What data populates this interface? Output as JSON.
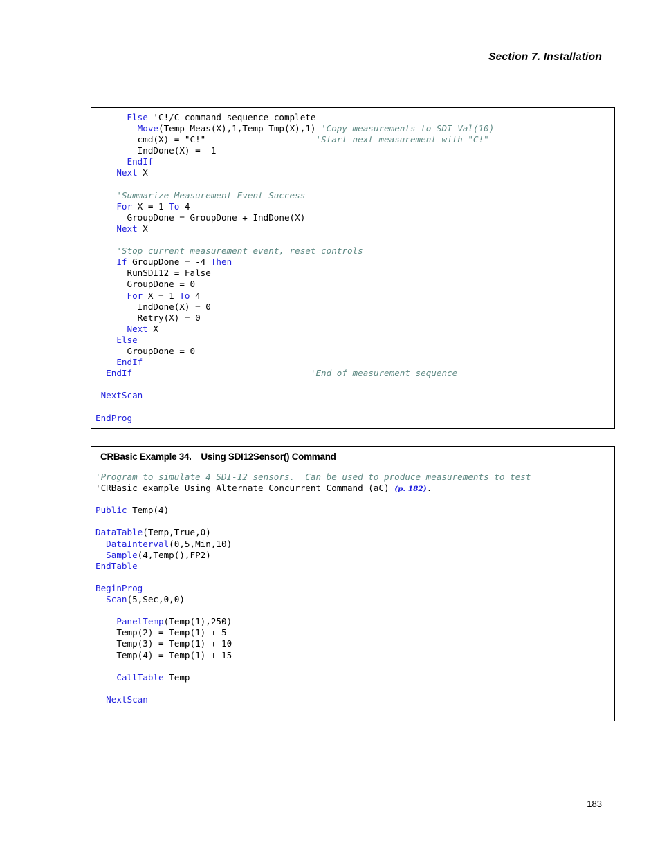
{
  "page": {
    "header_text": "Section 7.  Installation",
    "page_number": "183"
  },
  "blocks": [
    {
      "name": "crbasic-example-continued",
      "has_title": false,
      "title": "",
      "lines": [
        {
          "indent": 6,
          "segments": [
            {
              "t": "Else",
              "c": "kw"
            },
            {
              "t": " 'C!/C command sequence complete",
              "c": "plain"
            }
          ]
        },
        {
          "indent": 8,
          "segments": [
            {
              "t": "Move",
              "c": "kw"
            },
            {
              "t": "(Temp_Meas(X),1,Temp_Tmp(X),1) ",
              "c": "plain"
            },
            {
              "t": "'Copy measurements to SDI_Val(10)",
              "c": "cmt"
            }
          ]
        },
        {
          "indent": 8,
          "segments": [
            {
              "t": "cmd(X) = \"C!\"                     ",
              "c": "plain"
            },
            {
              "t": "'Start next measurement with \"C!\"",
              "c": "cmt"
            }
          ]
        },
        {
          "indent": 8,
          "segments": [
            {
              "t": "IndDone(X) = -1",
              "c": "plain"
            }
          ]
        },
        {
          "indent": 6,
          "segments": [
            {
              "t": "EndIf",
              "c": "kw"
            }
          ]
        },
        {
          "indent": 4,
          "segments": [
            {
              "t": "Next",
              "c": "kw"
            },
            {
              "t": " X",
              "c": "plain"
            }
          ]
        },
        {
          "indent": 0,
          "segments": [
            {
              "t": " ",
              "c": "plain"
            }
          ]
        },
        {
          "indent": 4,
          "segments": [
            {
              "t": "'Summarize Measurement Event Success",
              "c": "cmt"
            }
          ]
        },
        {
          "indent": 4,
          "segments": [
            {
              "t": "For",
              "c": "kw"
            },
            {
              "t": " X = 1 ",
              "c": "plain"
            },
            {
              "t": "To",
              "c": "kw"
            },
            {
              "t": " 4",
              "c": "plain"
            }
          ]
        },
        {
          "indent": 6,
          "segments": [
            {
              "t": "GroupDone = GroupDone + IndDone(X)",
              "c": "plain"
            }
          ]
        },
        {
          "indent": 4,
          "segments": [
            {
              "t": "Next",
              "c": "kw"
            },
            {
              "t": " X",
              "c": "plain"
            }
          ]
        },
        {
          "indent": 0,
          "segments": [
            {
              "t": " ",
              "c": "plain"
            }
          ]
        },
        {
          "indent": 4,
          "segments": [
            {
              "t": "'Stop current measurement event, reset controls",
              "c": "cmt"
            }
          ]
        },
        {
          "indent": 4,
          "segments": [
            {
              "t": "If",
              "c": "kw"
            },
            {
              "t": " GroupDone = -4 ",
              "c": "plain"
            },
            {
              "t": "Then",
              "c": "kw"
            }
          ]
        },
        {
          "indent": 6,
          "segments": [
            {
              "t": "RunSDI12 = False",
              "c": "plain"
            }
          ]
        },
        {
          "indent": 6,
          "segments": [
            {
              "t": "GroupDone = 0",
              "c": "plain"
            }
          ]
        },
        {
          "indent": 6,
          "segments": [
            {
              "t": "For",
              "c": "kw"
            },
            {
              "t": " X = 1 ",
              "c": "plain"
            },
            {
              "t": "To",
              "c": "kw"
            },
            {
              "t": " 4",
              "c": "plain"
            }
          ]
        },
        {
          "indent": 8,
          "segments": [
            {
              "t": "IndDone(X) = 0",
              "c": "plain"
            }
          ]
        },
        {
          "indent": 8,
          "segments": [
            {
              "t": "Retry(X) = 0",
              "c": "plain"
            }
          ]
        },
        {
          "indent": 6,
          "segments": [
            {
              "t": "Next",
              "c": "kw"
            },
            {
              "t": " X",
              "c": "plain"
            }
          ]
        },
        {
          "indent": 4,
          "segments": [
            {
              "t": "Else",
              "c": "kw"
            }
          ]
        },
        {
          "indent": 6,
          "segments": [
            {
              "t": "GroupDone = 0",
              "c": "plain"
            }
          ]
        },
        {
          "indent": 4,
          "segments": [
            {
              "t": "EndIf",
              "c": "kw"
            }
          ]
        },
        {
          "indent": 2,
          "segments": [
            {
              "t": "EndIf",
              "c": "kw"
            },
            {
              "t": "                                  ",
              "c": "plain"
            },
            {
              "t": "'End of measurement sequence",
              "c": "cmt"
            }
          ]
        },
        {
          "indent": 0,
          "segments": [
            {
              "t": " ",
              "c": "plain"
            }
          ]
        },
        {
          "indent": 1,
          "segments": [
            {
              "t": "NextScan",
              "c": "kw"
            }
          ]
        },
        {
          "indent": 0,
          "segments": [
            {
              "t": " ",
              "c": "plain"
            }
          ]
        },
        {
          "indent": 0,
          "segments": [
            {
              "t": "EndProg",
              "c": "kw"
            }
          ]
        }
      ]
    },
    {
      "name": "crbasic-example-34",
      "has_title": true,
      "title": "CRBasic Example 34.    Using SDI12Sensor() Command",
      "lines": [
        {
          "indent": 0,
          "segments": [
            {
              "t": "'Program to simulate 4 SDI-12 sensors.  Can be used to produce measurements to test",
              "c": "cmt"
            }
          ]
        },
        {
          "indent": 0,
          "segments": [
            {
              "t": "'CRBasic example Using Alternate Concurrent Command (aC) ",
              "c": "cmt-dark"
            },
            {
              "t": "(p. 182)",
              "c": "lnk"
            },
            {
              "t": ".",
              "c": "cmt-dark"
            }
          ]
        },
        {
          "indent": 0,
          "segments": [
            {
              "t": " ",
              "c": "plain"
            }
          ]
        },
        {
          "indent": 0,
          "segments": [
            {
              "t": "Public",
              "c": "kw"
            },
            {
              "t": " Temp(4)",
              "c": "plain"
            }
          ]
        },
        {
          "indent": 0,
          "segments": [
            {
              "t": " ",
              "c": "plain"
            }
          ]
        },
        {
          "indent": 0,
          "segments": [
            {
              "t": "DataTable",
              "c": "kw"
            },
            {
              "t": "(Temp,True,0)",
              "c": "plain"
            }
          ]
        },
        {
          "indent": 2,
          "segments": [
            {
              "t": "DataInterval",
              "c": "kw"
            },
            {
              "t": "(0,5,Min,10)",
              "c": "plain"
            }
          ]
        },
        {
          "indent": 2,
          "segments": [
            {
              "t": "Sample",
              "c": "kw"
            },
            {
              "t": "(4,Temp(),FP2)",
              "c": "plain"
            }
          ]
        },
        {
          "indent": 0,
          "segments": [
            {
              "t": "EndTable",
              "c": "kw"
            }
          ]
        },
        {
          "indent": 0,
          "segments": [
            {
              "t": " ",
              "c": "plain"
            }
          ]
        },
        {
          "indent": 0,
          "segments": [
            {
              "t": "BeginProg",
              "c": "kw"
            }
          ]
        },
        {
          "indent": 2,
          "segments": [
            {
              "t": "Scan",
              "c": "kw"
            },
            {
              "t": "(5,Sec,0,0)",
              "c": "plain"
            }
          ]
        },
        {
          "indent": 0,
          "segments": [
            {
              "t": " ",
              "c": "plain"
            }
          ]
        },
        {
          "indent": 4,
          "segments": [
            {
              "t": "PanelTemp",
              "c": "kw"
            },
            {
              "t": "(Temp(1),250)",
              "c": "plain"
            }
          ]
        },
        {
          "indent": 4,
          "segments": [
            {
              "t": "Temp(2) = Temp(1) + 5",
              "c": "plain"
            }
          ]
        },
        {
          "indent": 4,
          "segments": [
            {
              "t": "Temp(3) = Temp(1) + 10",
              "c": "plain"
            }
          ]
        },
        {
          "indent": 4,
          "segments": [
            {
              "t": "Temp(4) = Temp(1) + 15",
              "c": "plain"
            }
          ]
        },
        {
          "indent": 0,
          "segments": [
            {
              "t": " ",
              "c": "plain"
            }
          ]
        },
        {
          "indent": 4,
          "segments": [
            {
              "t": "CallTable",
              "c": "kw"
            },
            {
              "t": " Temp",
              "c": "plain"
            }
          ]
        },
        {
          "indent": 0,
          "segments": [
            {
              "t": " ",
              "c": "plain"
            }
          ]
        },
        {
          "indent": 2,
          "segments": [
            {
              "t": "NextScan",
              "c": "kw"
            }
          ]
        },
        {
          "indent": 0,
          "segments": [
            {
              "t": " ",
              "c": "plain"
            }
          ]
        }
      ]
    }
  ]
}
